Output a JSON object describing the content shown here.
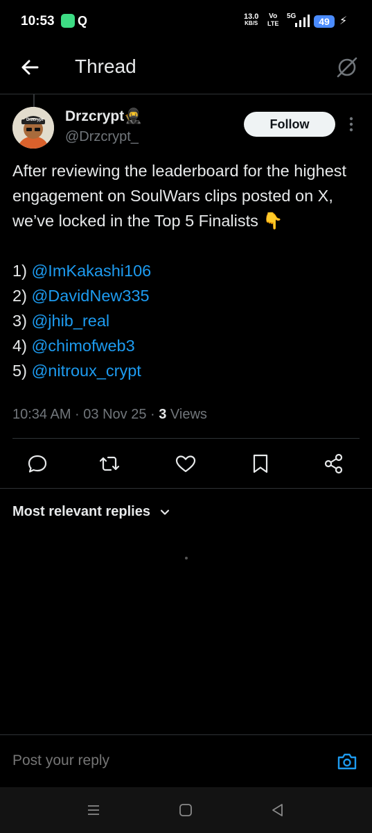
{
  "status": {
    "time": "10:53",
    "net_speed": "13.0",
    "net_unit": "KB/S",
    "volte_top": "Vo",
    "volte_bottom": "LTE",
    "signal": "5G",
    "battery": "49"
  },
  "header": {
    "title": "Thread"
  },
  "post": {
    "author_name": "Drzcrypt",
    "author_emoji": "🥷",
    "handle": "@Drzcrypt_",
    "avatar_text": "Drzcrypt",
    "follow_label": "Follow",
    "body_intro": "After reviewing the leaderboard for the highest engagement on SoulWars clips posted on X, we’ve locked in the Top 5 Finalists 👇",
    "finalists": [
      {
        "num": "1)",
        "mention": "@ImKakashi106"
      },
      {
        "num": "2)",
        "mention": "@DavidNew335"
      },
      {
        "num": "3)",
        "mention": "@jhib_real"
      },
      {
        "num": "4)",
        "mention": "@chimofweb3"
      },
      {
        "num": "5)",
        "mention": "@nitroux_crypt"
      }
    ],
    "timestamp": "10:34 AM · 03 Nov 25 · ",
    "views_count": "3",
    "views_label": " Views"
  },
  "replies": {
    "sort_label": "Most relevant replies"
  },
  "reply_bar": {
    "placeholder": "Post your reply"
  },
  "icons": {
    "back": "arrow-left-icon",
    "grok": "grok-icon",
    "reply": "reply-icon",
    "repost": "repost-icon",
    "like": "heart-icon",
    "bookmark": "bookmark-icon",
    "share": "share-icon",
    "camera": "camera-icon"
  },
  "colors": {
    "accent": "#1d9bf0",
    "battery": "#4b8cff"
  }
}
